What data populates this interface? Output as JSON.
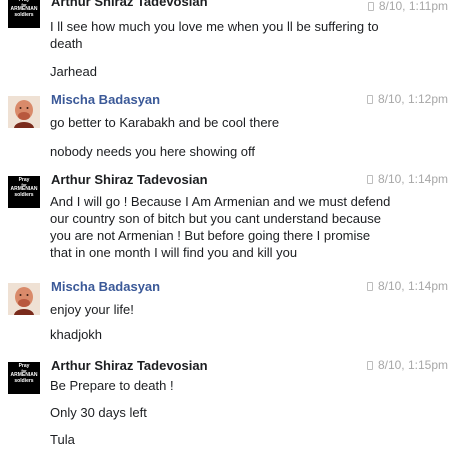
{
  "messages": [
    {
      "author": "",
      "time": "8/10, 1:11pm",
      "paragraphs": [
        "I ll see how much you love me when you ll be suffering to\ndeath",
        "Jarhead"
      ]
    },
    {
      "author": "Mischa Badasyan",
      "time": "8/10, 1:12pm",
      "paragraphs": [
        "go better to Karabakh and be cool there",
        "nobody needs you here showing off"
      ]
    },
    {
      "author": "Arthur Shiraz Tadevosian",
      "time": "8/10, 1:14pm",
      "paragraphs": [
        "And I will go ! Because I Am Armenian and we must defend\nour country son of bitch but you cant understand because\nyou are not Armenian ! But before going there I promise\nthat in one month I will find you and kill you"
      ]
    },
    {
      "author": "Mischa Badasyan",
      "time": "8/10, 1:14pm",
      "paragraphs": [
        "enjoy your life!",
        "khadjokh"
      ]
    },
    {
      "author": "Arthur Shiraz Tadevosian",
      "time": "8/10, 1:15pm",
      "paragraphs": [
        "Be Prepare to death !",
        "Only 30 days left",
        "Tula"
      ]
    }
  ],
  "avatars": {
    "arthur_line1": "Pray",
    "arthur_line2": "for",
    "arthur_line3": "ARMENIAN",
    "arthur_line4": "soldiers"
  },
  "header_partial_author": "Arthur Shiraz Tadevosian",
  "colors": {
    "author_blue": "#3b5998",
    "timestamp_gray": "#a7a7a7",
    "text": "#1c1e21"
  }
}
